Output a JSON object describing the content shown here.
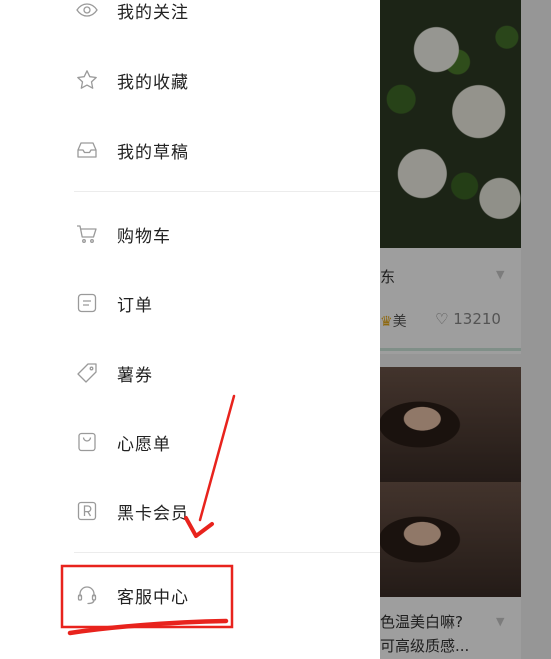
{
  "drawer": {
    "items": [
      {
        "label": "我的关注",
        "icon": "eye-icon"
      },
      {
        "label": "我的收藏",
        "icon": "star-icon"
      },
      {
        "label": "我的草稿",
        "icon": "draft-box-icon"
      },
      {
        "label": "购物车",
        "icon": "cart-icon"
      },
      {
        "label": "订单",
        "icon": "order-icon"
      },
      {
        "label": "薯券",
        "icon": "coupon-tag-icon"
      },
      {
        "label": "心愿单",
        "icon": "wishlist-bag-icon"
      },
      {
        "label": "黑卡会员",
        "icon": "black-card-r-icon"
      },
      {
        "label": "客服中心",
        "icon": "headset-icon"
      }
    ]
  },
  "feed": {
    "card1": {
      "title_fragment": "东",
      "user_fragment": "美",
      "likes": "13210"
    },
    "card2": {
      "line1": "色温美白嘛?",
      "line2": "可高级质感..."
    }
  },
  "annotation": {
    "color": "#e8231d"
  },
  "colors": {
    "text": "#222222",
    "icon_stroke": "#9a9a9a",
    "divider": "#ececec"
  }
}
